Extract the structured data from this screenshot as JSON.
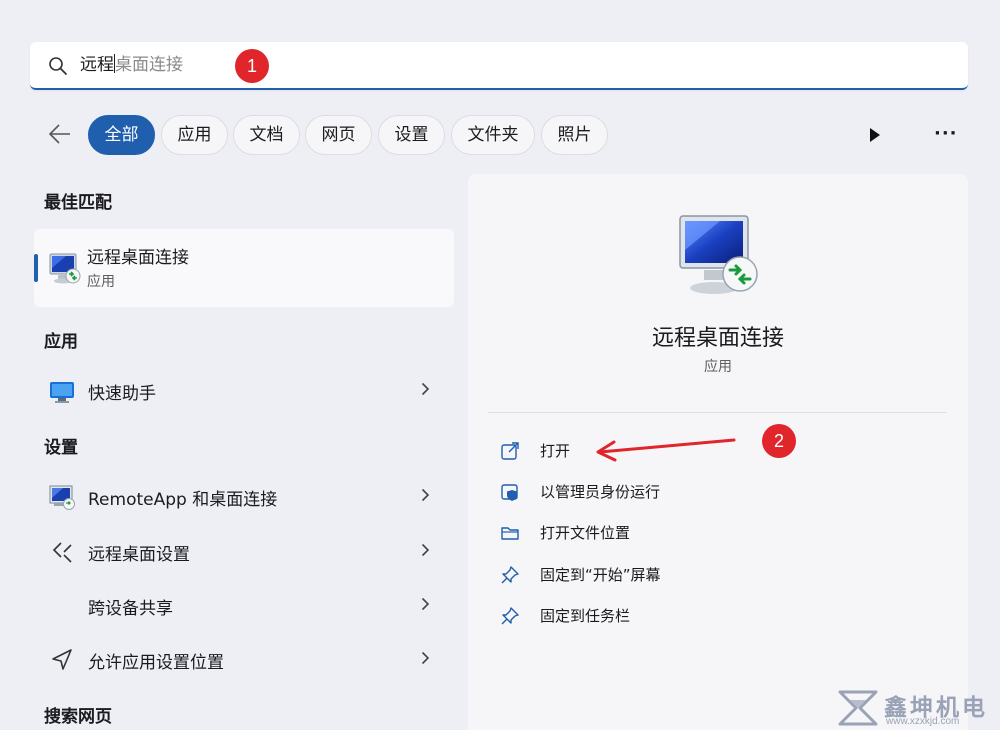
{
  "search": {
    "typed": "远程",
    "suggestion": "桌面连接"
  },
  "annotations": {
    "badge1": "1",
    "badge2": "2"
  },
  "filters": [
    {
      "label": "全部",
      "active": true
    },
    {
      "label": "应用"
    },
    {
      "label": "文档"
    },
    {
      "label": "网页"
    },
    {
      "label": "设置"
    },
    {
      "label": "文件夹"
    },
    {
      "label": "照片"
    }
  ],
  "sections": {
    "best_match": "最佳匹配",
    "apps": "应用",
    "settings": "设置",
    "web": "搜索网页"
  },
  "best_match": {
    "title": "远程桌面连接",
    "subtitle": "应用",
    "icon": "remote-desktop-icon"
  },
  "apps": [
    {
      "label": "快速助手",
      "icon": "quick-assist-icon"
    }
  ],
  "settings": [
    {
      "label": "RemoteApp 和桌面连接",
      "icon": "remoteapp-icon"
    },
    {
      "label": "远程桌面设置",
      "icon": "remote-settings-icon"
    },
    {
      "label": "跨设备共享",
      "icon": ""
    },
    {
      "label": "允许应用设置位置",
      "icon": "location-icon"
    }
  ],
  "detail": {
    "title": "远程桌面连接",
    "subtitle": "应用",
    "actions": [
      {
        "label": "打开",
        "icon": "open-external-icon"
      },
      {
        "label": "以管理员身份运行",
        "icon": "admin-shield-icon"
      },
      {
        "label": "打开文件位置",
        "icon": "folder-icon"
      },
      {
        "label": "固定到“开始”屏幕",
        "icon": "pin-icon"
      },
      {
        "label": "固定到任务栏",
        "icon": "pin-icon"
      }
    ]
  },
  "watermark": {
    "title": "鑫坤机电",
    "url": "www.xzxkjd.com"
  },
  "colors": {
    "accent": "#1f5fae",
    "annotation": "#e0252b"
  }
}
